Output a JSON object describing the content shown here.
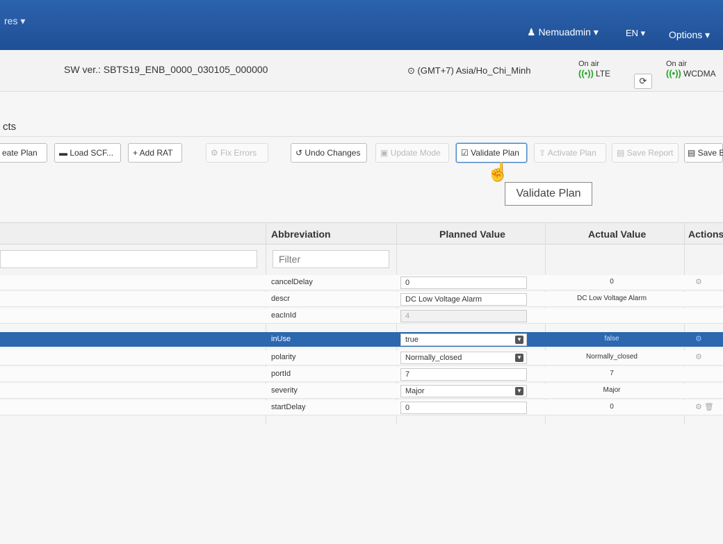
{
  "topbar": {
    "menu_fragment": "res ▾",
    "user": "♟ Nemuadmin ▾",
    "lang": "EN ▾",
    "options": "Options ▾"
  },
  "info": {
    "sw_version": "SW ver.: SBTS19_ENB_0000_030105_000000",
    "timezone": "⊙ (GMT+7) Asia/Ho_Chi_Minh",
    "lte": {
      "label": "On air",
      "signal": "((•))",
      "rat": "LTE"
    },
    "wcdma": {
      "label": "On air",
      "signal": "((•))",
      "rat": "WCDMA"
    },
    "refresh_icon": "⟳"
  },
  "section": {
    "title": "cts"
  },
  "toolbar": {
    "create_plan": "eate Plan",
    "load_scf": "▬ Load SCF...",
    "add_rat": "+ Add RAT",
    "fix_errors": "⚙ Fix Errors",
    "undo_changes": "↺ Undo Changes",
    "update_mode": "▣ Update Mode",
    "validate_plan": "☑ Validate Plan",
    "activate_plan": "⇪ Activate Plan",
    "save_report": "▤ Save Report",
    "save_b": "▤ Save B"
  },
  "tooltip": "Validate Plan",
  "table": {
    "headers": {
      "abbreviation": "Abbreviation",
      "planned": "Planned Value",
      "actual": "Actual Value",
      "actions": "Actions"
    },
    "filter_placeholder": "Filter",
    "rows": [
      {
        "abbr": "cancelDelay",
        "planned": "0",
        "actual": "0",
        "action": "⚙",
        "kind": "text"
      },
      {
        "abbr": "descr",
        "planned": "DC Low Voltage Alarm",
        "actual": "DC Low Voltage Alarm",
        "action": "",
        "kind": "text"
      },
      {
        "abbr": "eacInId",
        "planned": "4",
        "actual": "",
        "action": "",
        "kind": "readonly"
      },
      {
        "abbr": "inUse",
        "planned": "true",
        "actual": "false",
        "action": "⚙",
        "kind": "select"
      },
      {
        "abbr": "polarity",
        "planned": "Normally_closed",
        "actual": "Normally_closed",
        "action": "⚙",
        "kind": "select"
      },
      {
        "abbr": "portId",
        "planned": "7",
        "actual": "7",
        "action": "",
        "kind": "text"
      },
      {
        "abbr": "severity",
        "planned": "Major",
        "actual": "Major",
        "action": "",
        "kind": "select"
      },
      {
        "abbr": "startDelay",
        "planned": "0",
        "actual": "0",
        "action": "⚙ 🗑",
        "kind": "text"
      }
    ]
  },
  "colors": {
    "topbar": "#2c63ad",
    "selected_row": "#2c67b0",
    "signal_green": "#22a822"
  }
}
